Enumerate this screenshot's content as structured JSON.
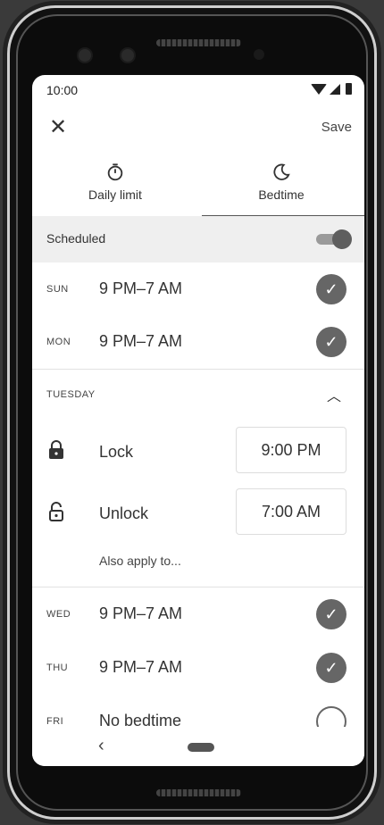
{
  "status_bar": {
    "time": "10:00"
  },
  "app_bar": {
    "close_label": "✕",
    "save_label": "Save"
  },
  "tabs": [
    {
      "label": "Daily limit",
      "icon": "timer-icon",
      "active": false
    },
    {
      "label": "Bedtime",
      "icon": "moon-icon",
      "active": true
    }
  ],
  "scheduled": {
    "label": "Scheduled",
    "enabled": true
  },
  "days_top": [
    {
      "day": "SUN",
      "range": "9 PM–7 AM",
      "checked": true
    },
    {
      "day": "MON",
      "range": "9 PM–7 AM",
      "checked": true
    }
  ],
  "expanded": {
    "day_label": "TUESDAY",
    "lock": {
      "label": "Lock",
      "time": "9:00 PM"
    },
    "unlock": {
      "label": "Unlock",
      "time": "7:00 AM"
    },
    "also_apply": "Also apply to..."
  },
  "days_bottom": [
    {
      "day": "WED",
      "range": "9 PM–7 AM",
      "checked": true
    },
    {
      "day": "THU",
      "range": "9 PM–7 AM",
      "checked": true
    },
    {
      "day": "FRI",
      "range": "No bedtime",
      "checked": false
    }
  ],
  "nav": {
    "back_label": "‹"
  },
  "colors": {
    "accent": "#666666",
    "scheduled_bg": "#efefef"
  }
}
